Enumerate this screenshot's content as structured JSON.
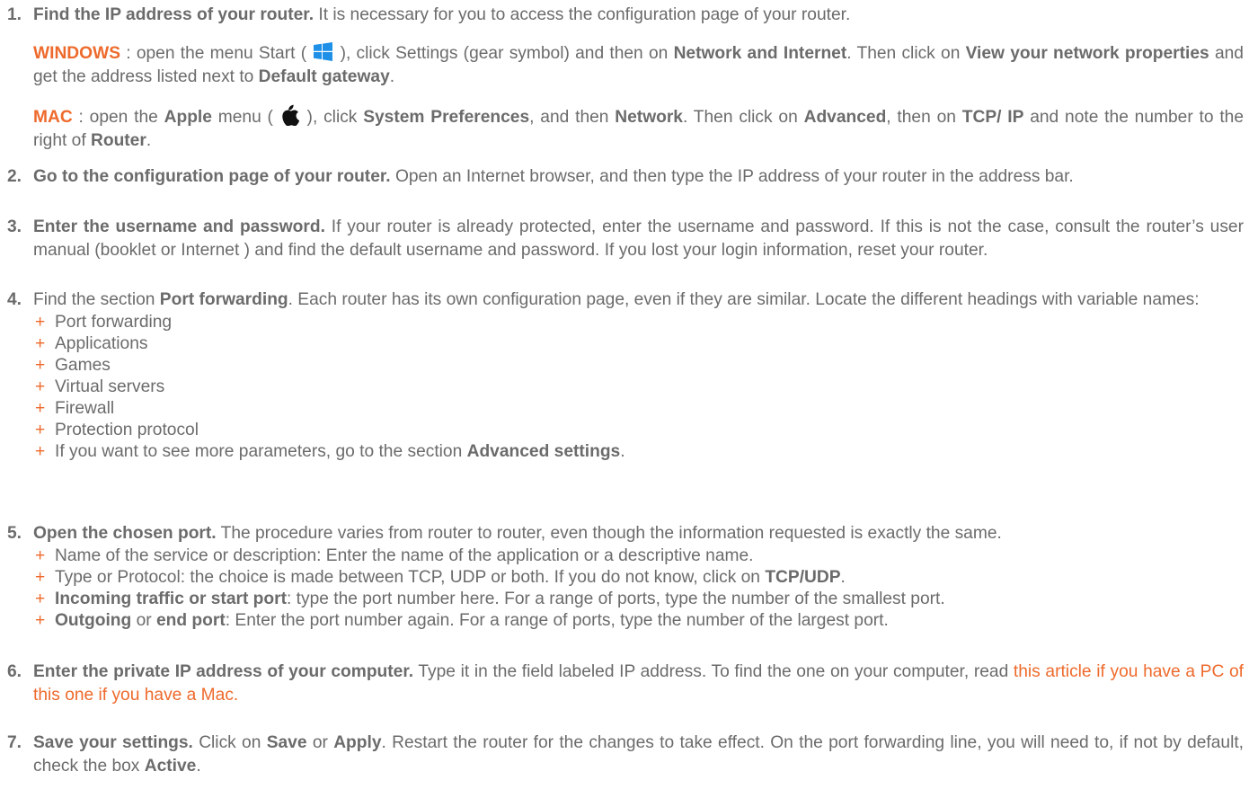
{
  "colors": {
    "text": "#6b6b6b",
    "accent": "#ee6a2c",
    "windows_blue": "#1e90e8"
  },
  "icons": {
    "windows": "windows-logo-icon",
    "apple": "apple-logo-icon"
  },
  "steps": [
    {
      "number": "1.",
      "title": "Find the IP address of your router.",
      "text": " It is necessary for you to access the configuration page of your router.",
      "windows": {
        "label": "WINDOWS",
        "t1": " : open the menu Start ( ",
        "t2": " ), click Settings (gear symbol) and then on ",
        "b1": "Network and Internet",
        "t3": ". Then click on ",
        "b2": "View your network properties",
        "t4": " and get the address listed next to ",
        "b3": "Default gateway",
        "t5": "."
      },
      "mac": {
        "label": "MAC",
        "t1": " : open the ",
        "b1": "Apple",
        "t2": " menu ( ",
        "t3": " ), click ",
        "b2": "System Preferences",
        "t4": ", and then ",
        "b3": "Network",
        "t5": ". Then click on  ",
        "b4": "Advanced",
        "t6": ", then on ",
        "b5": "TCP/ IP",
        "t7": " and note the number to the right of ",
        "b6": "Router",
        "t8": "."
      }
    },
    {
      "number": "2.",
      "title": "Go to the configuration page of your router.",
      "text": " Open an Internet browser, and then type the IP address of your router in the address bar."
    },
    {
      "number": "3.",
      "title": "Enter the username and password.",
      "text": " If your router is already protected, enter the username and password. If this is not the case, consult the router’s user manual (booklet or Internet ) and find the default username and password. If you lost your login information, reset your router."
    },
    {
      "number": "4.",
      "pre": "Find the section ",
      "bold": "Port forwarding",
      "text": ". Each router has its own configuration page, even if they are similar. Locate the different headings with variable names:",
      "bullets": [
        "Port forwarding",
        "Applications",
        "Games",
        "Virtual servers",
        "Firewall",
        "Protection protocol"
      ],
      "last_bullet": {
        "pre": "If you want to see more parameters, go to the section ",
        "bold": "Advanced settings",
        "post": "."
      }
    },
    {
      "number": "5.",
      "title": "Open the chosen port.",
      "text": " The procedure varies from router to router, even though the information requested is exactly the same.",
      "b1": "Name of the service or description: Enter the name of the application or a descriptive name.",
      "b2": {
        "pre": "Type or Protocol: the choice is made between TCP, UDP or both. If you do not know, click on ",
        "bold": "TCP/UDP",
        "post": "."
      },
      "b3": {
        "bold": "Incoming traffic or start port",
        "post": ": type the port number here. For a range of ports, type the number of the smallest port."
      },
      "b4": {
        "bold1": "Outgoing",
        "mid": " or ",
        "bold2": "end port",
        "post": ": Enter the port number again. For a range of ports, type the number of the largest port."
      }
    },
    {
      "number": "6.",
      "title": "Enter the private IP address of your computer.",
      "text": " Type it in the field labeled IP address. To find the one on your computer, read ",
      "link1": "this article if you have a PC",
      "mid": " of ",
      "link2": "this one if you have a Mac",
      "end": "."
    },
    {
      "number": "7.",
      "title": "Save your settings.",
      "t1": " Click on ",
      "b1": "Save",
      "t2": " or ",
      "b2": "Apply",
      "t3": ". Restart the router for the changes to take effect. On the port forwarding line, you will need to, if not by default, check the box ",
      "b3": "Active",
      "t4": "."
    }
  ]
}
